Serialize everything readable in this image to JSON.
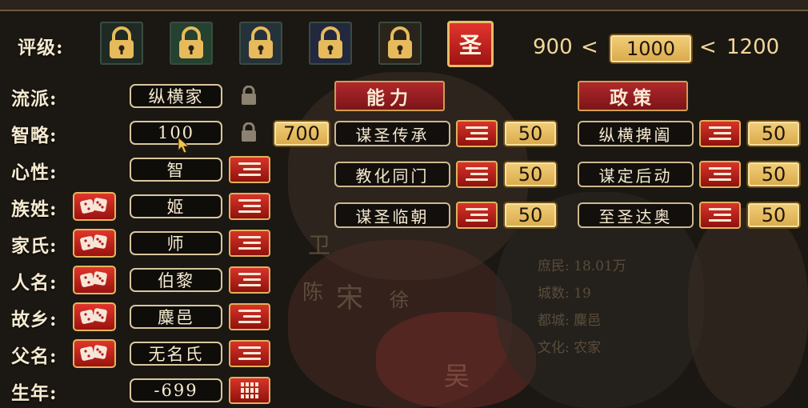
{
  "rating": {
    "label": "评级:",
    "locks": [
      "lock-icon",
      "lock-icon",
      "lock-icon",
      "lock-icon",
      "lock-icon"
    ],
    "selected_badge": "圣",
    "min": "900",
    "lt1": "<",
    "value": "1000",
    "lt2": "<",
    "max": "1200"
  },
  "attributes": [
    {
      "key": "school",
      "label": "流派:",
      "value": "纵横家"
    },
    {
      "key": "wisdom",
      "label": "智略:",
      "value": "100"
    },
    {
      "key": "nature",
      "label": "心性:",
      "value": "智"
    },
    {
      "key": "clan",
      "label": "族姓:",
      "value": "姬"
    },
    {
      "key": "family",
      "label": "家氏:",
      "value": "师"
    },
    {
      "key": "name",
      "label": "人名:",
      "value": "伯黎"
    },
    {
      "key": "hometown",
      "label": "故乡:",
      "value": "麋邑"
    },
    {
      "key": "father",
      "label": "父名:",
      "value": "无名氏"
    },
    {
      "key": "birthyear",
      "label": "生年:",
      "value": "-699"
    }
  ],
  "points": "700",
  "abilities": {
    "header": "能力",
    "items": [
      {
        "name": "谋圣传承",
        "value": "50"
      },
      {
        "name": "教化同门",
        "value": "50"
      },
      {
        "name": "谋圣临朝",
        "value": "50"
      }
    ]
  },
  "policies": {
    "header": "政策",
    "items": [
      {
        "name": "纵横捭阖",
        "value": "50"
      },
      {
        "name": "谋定后动",
        "value": "50"
      },
      {
        "name": "至圣达奥",
        "value": "50"
      }
    ]
  },
  "background_text": {
    "stat1": "庶民: 18.01万",
    "stat2": "城数: 19",
    "stat3": "都城: 麋邑",
    "stat4": "文化: 农家",
    "map_song": "宋",
    "map_wu": "吴",
    "map_wei": "卫",
    "map_chen": "陈",
    "map_xu": "徐"
  },
  "colors": {
    "accent_gold": "#e7bb5c",
    "accent_red": "#c22a24",
    "panel_dark": "#0f0d0a"
  }
}
